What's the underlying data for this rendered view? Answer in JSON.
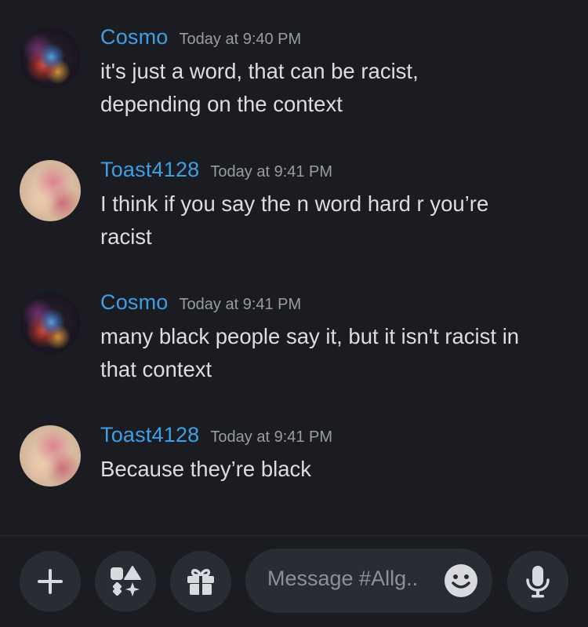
{
  "messages": [
    {
      "author": "Cosmo",
      "time": "Today at 9:40 PM",
      "lines": [
        "it's just a word, that can be racist,",
        "depending on the context"
      ]
    },
    {
      "author": "Toast4128",
      "time": "Today at 9:41 PM",
      "lines": [
        "I think if you say the n word hard r you’re",
        "racist"
      ]
    },
    {
      "author": "Cosmo",
      "time": "Today at 9:41 PM",
      "lines": [
        "many black people say it, but it isn't racist in",
        "that context"
      ]
    },
    {
      "author": "Toast4128",
      "time": "Today at 9:41 PM",
      "lines": [
        "Because they’re black"
      ]
    }
  ],
  "composer": {
    "placeholder": "Message #Allg..",
    "icons": [
      "plus-icon",
      "apps-icon",
      "gift-icon",
      "emoji-icon",
      "microphone-icon"
    ]
  },
  "colors": {
    "background": "#1b1c21",
    "username": "#3d9fe6",
    "timestamp": "#9a9ca4",
    "message_text": "#dcdde1",
    "button_bg": "#2a2c33",
    "icon": "#d9dadf"
  }
}
